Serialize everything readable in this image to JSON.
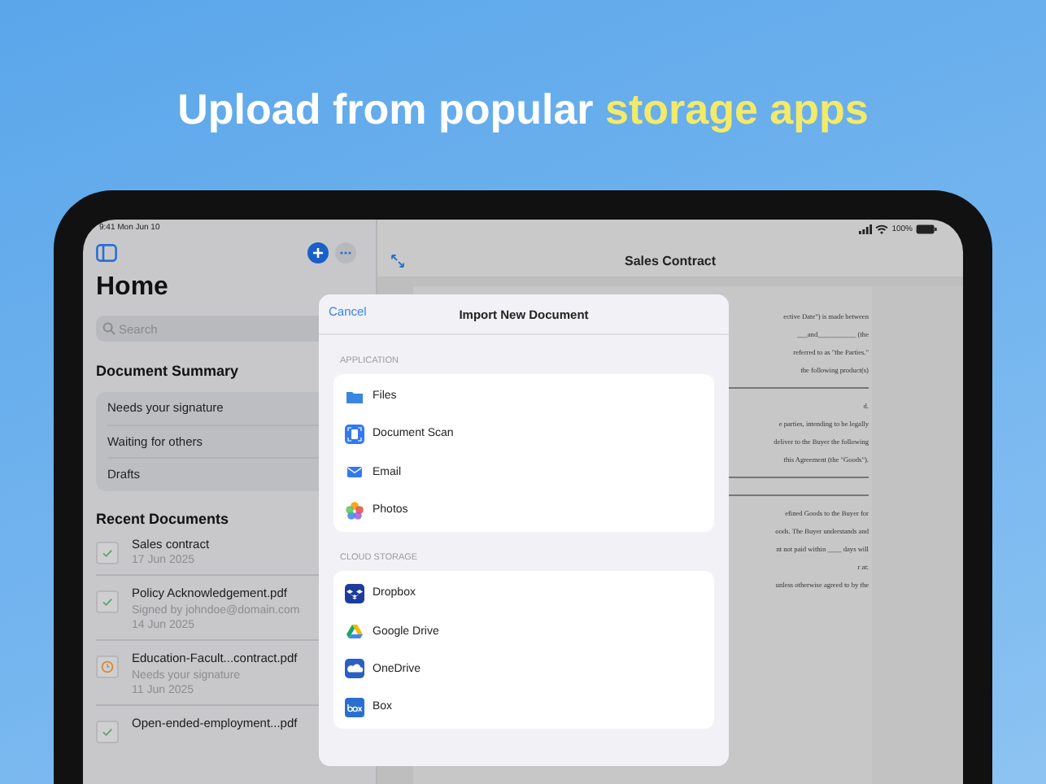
{
  "headline": {
    "text": "Upload from popular",
    "highlight": "storage apps"
  },
  "sidebar": {
    "status_time": "9:41  Mon Jun 10",
    "title": "Home",
    "search": {
      "placeholder": "Search"
    },
    "summary_title": "Document Summary",
    "summary_items": [
      "Needs your signature",
      "Waiting for others",
      "Drafts"
    ],
    "recent_title": "Recent Documents",
    "recent": [
      {
        "kind": "signed",
        "title": "Sales contract",
        "lines": [
          "17 Jun 2025"
        ]
      },
      {
        "kind": "signed",
        "title": "Policy Acknowledgement.pdf",
        "lines": [
          "Signed by johndoe@domain.com",
          "14 Jun 2025"
        ]
      },
      {
        "kind": "pending",
        "title": "Education-Facult...contract.pdf",
        "lines": [
          "Needs your signature",
          "11 Jun 2025"
        ]
      },
      {
        "kind": "signed",
        "title": "Open-ended-employment...pdf"
      }
    ]
  },
  "main": {
    "battery": "100%",
    "title": "Sales Contract",
    "document": [
      {
        "kind": "text",
        "lines": [
          "ective Date\") is made between",
          "___and___________ (the",
          "referred to as \"the Parties.\""
        ]
      },
      {
        "kind": "text",
        "lines": [
          "the    following    product(s)"
        ]
      },
      {
        "kind": "rule"
      },
      {
        "kind": "text",
        "lines": [
          "d."
        ]
      },
      {
        "kind": "text",
        "lines": [
          "e parties, intending to be legally"
        ]
      },
      {
        "kind": "text",
        "lines": [
          "deliver to the Buyer the following"
        ]
      },
      {
        "kind": "text",
        "lines": [
          "this Agreement (the \"Goods\")."
        ]
      },
      {
        "kind": "rule"
      },
      {
        "kind": "rule"
      },
      {
        "kind": "text",
        "lines": [
          "efined Goods to the Buyer for"
        ]
      },
      {
        "kind": "text",
        "lines": [
          "oods. The Buyer understands and",
          "nt not paid within ____ days will"
        ]
      },
      {
        "kind": "text",
        "lines": [
          "r at:"
        ]
      },
      {
        "kind": "text",
        "lines": [
          "unless otherwise agreed to by the"
        ]
      }
    ]
  },
  "modal": {
    "cancel": "Cancel",
    "title": "Import New Document",
    "sections": [
      {
        "label": "APPLICATION",
        "items": [
          "Files",
          "Document Scan",
          "Email",
          "Photos"
        ]
      },
      {
        "label": "CLOUD STORAGE",
        "items": [
          "Dropbox",
          "Google Drive",
          "OneDrive",
          "Box"
        ]
      }
    ]
  }
}
